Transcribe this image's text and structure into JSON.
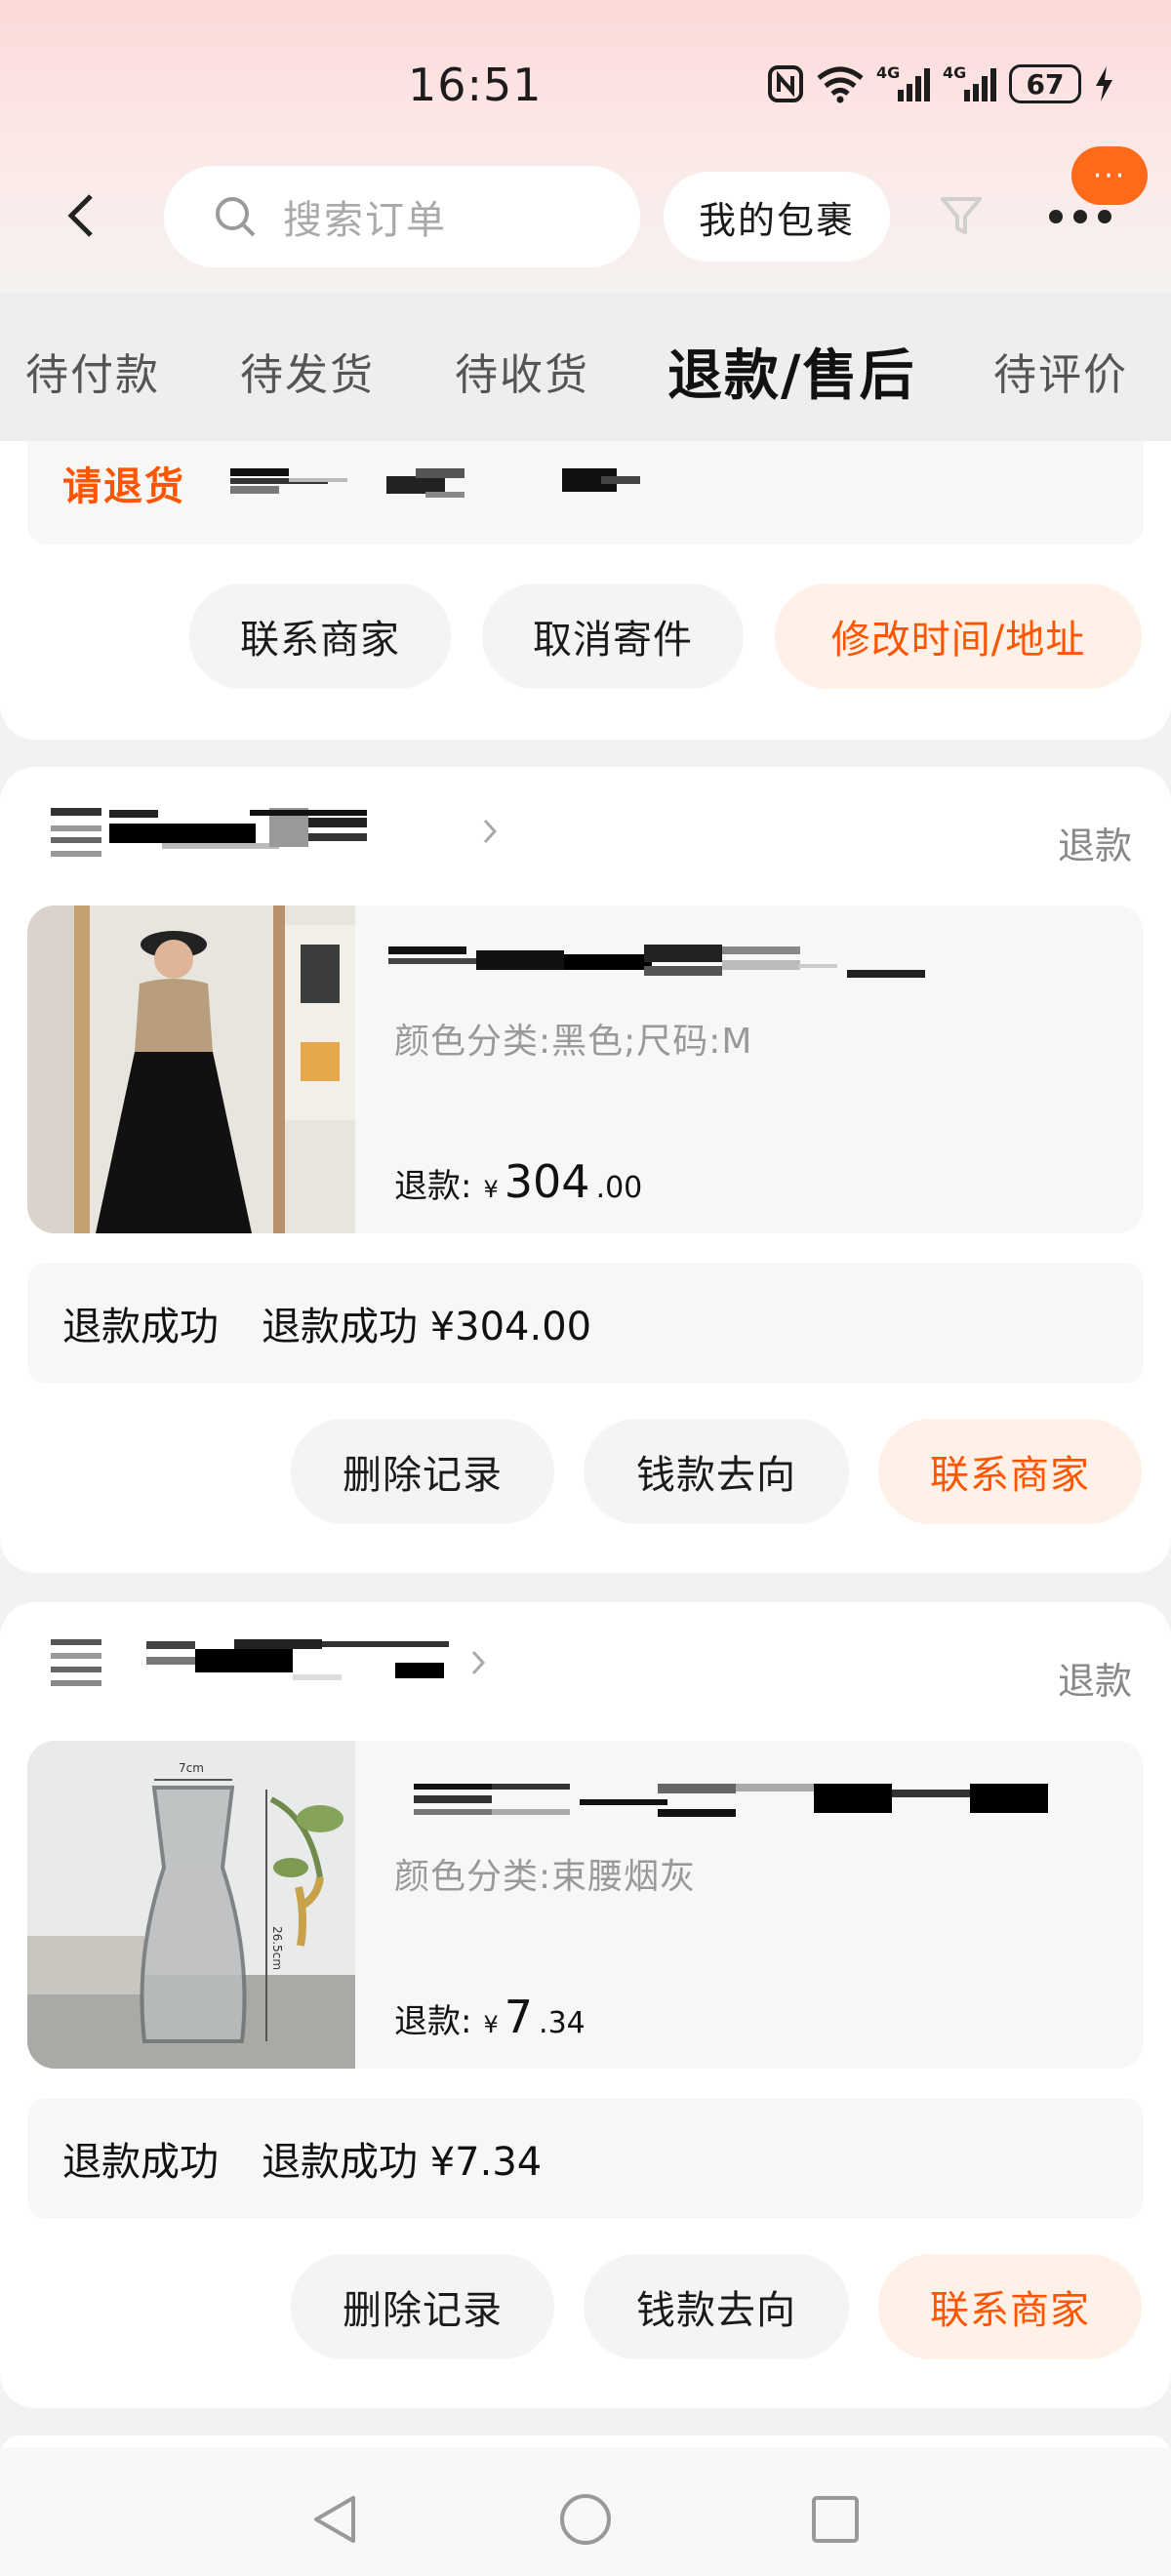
{
  "status_bar": {
    "time": "16:51",
    "battery": "67",
    "net1": "4G",
    "net2": "4G"
  },
  "header": {
    "search_placeholder": "搜索订单",
    "my_packages": "我的包裹",
    "badge": "···"
  },
  "tabs": [
    {
      "label": "待付款"
    },
    {
      "label": "待发货"
    },
    {
      "label": "待收货"
    },
    {
      "label": "退款/售后",
      "active": true
    },
    {
      "label": "待评价"
    }
  ],
  "card_top": {
    "status": "请退货",
    "buttons": [
      "联系商家",
      "取消寄件",
      "修改时间/地址"
    ]
  },
  "orders": [
    {
      "status": "退款",
      "sku": "颜色分类:黑色;尺码:M",
      "refund_label": "退款:",
      "currency": "¥",
      "price_int": "304",
      "price_dec": ".00",
      "summary_status": "退款成功",
      "summary_detail": "退款成功 ¥304.00",
      "buttons": [
        "删除记录",
        "钱款去向",
        "联系商家"
      ]
    },
    {
      "status": "退款",
      "sku": "颜色分类:束腰烟灰",
      "refund_label": "退款:",
      "currency": "¥",
      "price_int": "7",
      "price_dec": ".34",
      "summary_status": "退款成功",
      "summary_detail": "退款成功 ¥7.34",
      "buttons": [
        "删除记录",
        "钱款去向",
        "联系商家"
      ],
      "image_labels": {
        "width": "7cm",
        "height": "26.5cm"
      }
    }
  ],
  "colors": {
    "accent": "#ff5500",
    "accent_bg": "#fff0e8",
    "pill_bg": "#f4f4f4"
  }
}
